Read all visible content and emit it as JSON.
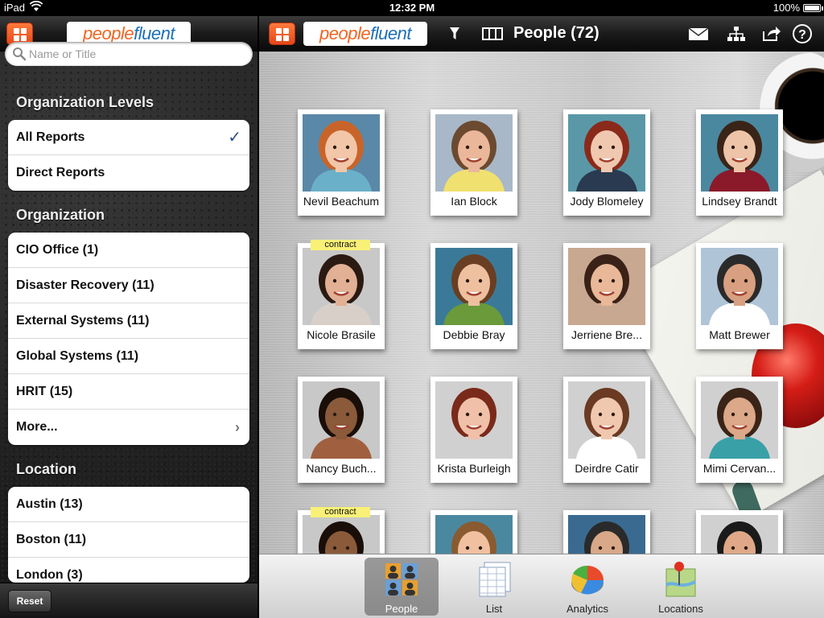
{
  "status_bar": {
    "carrier": "iPad",
    "time": "12:32 PM",
    "battery": "100%"
  },
  "brand": {
    "logo_part1": "people",
    "logo_part2": "fluent",
    "accent": "#f26522",
    "brand_blue": "#1d6fb8"
  },
  "header": {
    "title": "People (72)"
  },
  "search": {
    "placeholder": "Name or Title",
    "value": ""
  },
  "sidebar": {
    "sections": [
      {
        "heading": "Organization Levels",
        "items": [
          {
            "label": "All Reports",
            "checked": true
          },
          {
            "label": "Direct Reports"
          }
        ]
      },
      {
        "heading": "Organization",
        "items": [
          {
            "label": "CIO Office (1)"
          },
          {
            "label": "Disaster Recovery (11)"
          },
          {
            "label": "External Systems (11)"
          },
          {
            "label": "Global Systems (11)"
          },
          {
            "label": "HRIT (15)"
          },
          {
            "label": "More..."
          }
        ]
      },
      {
        "heading": "Location",
        "items": [
          {
            "label": "Austin (13)"
          },
          {
            "label": "Boston (11)"
          },
          {
            "label": "London (3)"
          }
        ]
      }
    ],
    "reset_label": "Reset"
  },
  "people": [
    {
      "name": "Nevil Beachum",
      "tag": "",
      "skin": "#f2c6a8",
      "hair": "#c8642a",
      "bg": "#5a88a8",
      "shirt": "#6ab0c8"
    },
    {
      "name": "Ian Block",
      "tag": "",
      "skin": "#eab79a",
      "hair": "#6b4a30",
      "bg": "#a8b8c8",
      "shirt": "#f0e070"
    },
    {
      "name": "Jody Blomeley",
      "tag": "",
      "skin": "#f0c8b0",
      "hair": "#8a2a1a",
      "bg": "#5a98a8",
      "shirt": "#2a3a50"
    },
    {
      "name": "Lindsey Brandt",
      "tag": "",
      "skin": "#eec4a8",
      "hair": "#3a2418",
      "bg": "#4a88a0",
      "shirt": "#8a1a2a"
    },
    {
      "name": "Nicole Brasile",
      "tag": "contract",
      "skin": "#e2b094",
      "hair": "#2a1a12",
      "bg": "#c8c8c8",
      "shirt": "#d8d0c8"
    },
    {
      "name": "Debbie Bray",
      "tag": "",
      "skin": "#eec0a0",
      "hair": "#6a3e22",
      "bg": "#3a7a98",
      "shirt": "#6a9a3a"
    },
    {
      "name": "Jerriene Bre...",
      "tag": "",
      "skin": "#e8b898",
      "hair": "#3a2218",
      "bg": "#c8a890",
      "shirt": "#c8a890"
    },
    {
      "name": "Matt Brewer",
      "tag": "",
      "skin": "#d8a080",
      "hair": "#2a2a2a",
      "bg": "#b0c4d8",
      "shirt": "#ffffff"
    },
    {
      "name": "Nancy Buch...",
      "tag": "",
      "skin": "#8a5a3a",
      "hair": "#1a0e08",
      "bg": "#c8c8c8",
      "shirt": "#a06040"
    },
    {
      "name": "Krista Burleigh",
      "tag": "",
      "skin": "#f0c0a8",
      "hair": "#7a2a1a",
      "bg": "#d0d0d0",
      "shirt": "#d0d0d0"
    },
    {
      "name": "Deirdre Catir",
      "tag": "",
      "skin": "#f0c8b0",
      "hair": "#6a3a22",
      "bg": "#d0d0d0",
      "shirt": "#ffffff"
    },
    {
      "name": "Mimi Cervan...",
      "tag": "",
      "skin": "#dca88a",
      "hair": "#3a2418",
      "bg": "#d0d0d0",
      "shirt": "#3aa0a8"
    },
    {
      "name": "",
      "tag": "contract",
      "skin": "#8a5a3a",
      "hair": "#1a0e08",
      "bg": "#c8c8c8",
      "shirt": "#a06040"
    },
    {
      "name": "",
      "tag": "",
      "skin": "#f0c0a0",
      "hair": "#8a5a30",
      "bg": "#4a88a0",
      "shirt": "#4a88a0"
    },
    {
      "name": "",
      "tag": "",
      "skin": "#d8a888",
      "hair": "#2a2a2a",
      "bg": "#3a6a90",
      "shirt": "#3a6a90"
    },
    {
      "name": "",
      "tag": "",
      "skin": "#e0a888",
      "hair": "#1a1a1a",
      "bg": "#d0d0d0",
      "shirt": "#ffffff"
    }
  ],
  "tabs": [
    {
      "label": "People",
      "icon": "people-icon",
      "active": true
    },
    {
      "label": "List",
      "icon": "list-icon",
      "active": false
    },
    {
      "label": "Analytics",
      "icon": "pie-chart-icon",
      "active": false
    },
    {
      "label": "Locations",
      "icon": "map-pin-icon",
      "active": false
    }
  ],
  "toolbar_icons": [
    "filter-icon",
    "columns-icon",
    "mail-icon",
    "org-chart-icon",
    "share-icon",
    "help-icon"
  ]
}
